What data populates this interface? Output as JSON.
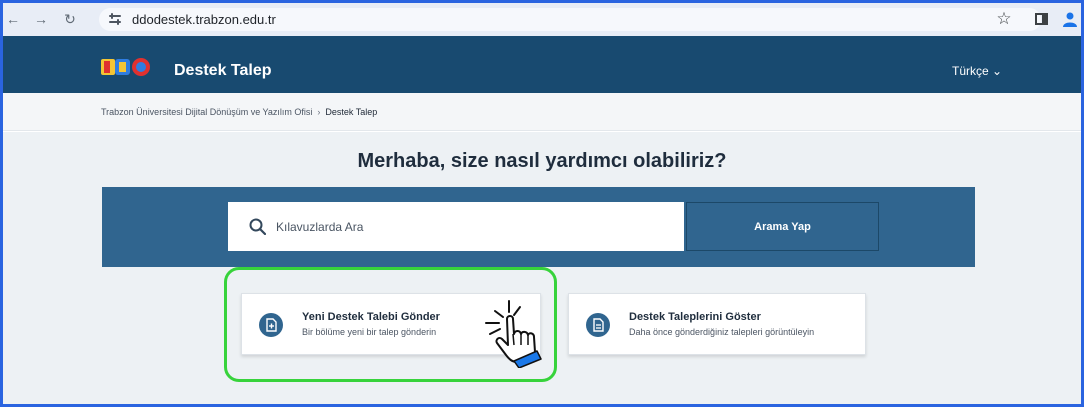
{
  "browser": {
    "url": "ddodestek.trabzon.edu.tr",
    "icons": [
      "back-arrow-icon",
      "forward-arrow-icon",
      "reload-icon",
      "site-info-icon",
      "bookmark-star-icon",
      "side-panel-icon",
      "profile-icon"
    ]
  },
  "header": {
    "brand": "Destek Talep",
    "language": "Türkçe ⌄",
    "colors": {
      "bar": "#184a70",
      "text": "#ffffff"
    }
  },
  "breadcrumb": {
    "items": [
      "Trabzon Üniversitesi Dijital Dönüşüm ve Yazılım Ofisi",
      "Destek Talep"
    ],
    "separator": "›"
  },
  "main": {
    "headline": "Merhaba, size nasıl yardımcı olabiliriz?",
    "search": {
      "placeholder": "Kılavuzlarda Ara",
      "button": "Arama Yap",
      "band_color": "#30658f"
    },
    "cards": [
      {
        "icon": "new-request-icon",
        "title": "Yeni Destek Talebi Gönder",
        "subtitle": "Bir bölüme yeni bir talep gönderin"
      },
      {
        "icon": "document-list-icon",
        "title": "Destek Taleplerini Göster",
        "subtitle": "Daha önce gönderdiğiniz talepleri görüntüleyin"
      }
    ],
    "highlight_color": "#37d33b",
    "pointer_icon": "hand-pointer-icon"
  }
}
